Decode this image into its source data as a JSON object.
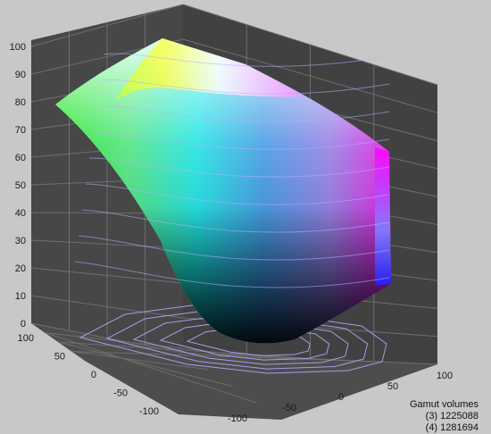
{
  "chart_data": {
    "type": "surface3d",
    "title": "",
    "z_axis": {
      "ticks": [
        "0",
        "10",
        "20",
        "30",
        "40",
        "50",
        "60",
        "70",
        "80",
        "90",
        "100"
      ],
      "range": [
        0,
        100
      ]
    },
    "left_axis": {
      "ticks": [
        "100",
        "50",
        "0",
        "-50",
        "-100"
      ],
      "range": [
        -100,
        100
      ]
    },
    "right_axis": {
      "ticks": [
        "-100",
        "-50",
        "0",
        "50",
        "100"
      ],
      "range": [
        -100,
        100
      ]
    },
    "grid": true,
    "legend": {
      "title": "Gamut volumes",
      "entries": [
        {
          "label": "(3)",
          "value": "1225088"
        },
        {
          "label": "(4)",
          "value": "1281694"
        }
      ],
      "placement": "bottom-right"
    }
  },
  "colors": {
    "background": "#c8c8c8",
    "pane": "#4a4a4a",
    "grid": "#6b6b6b",
    "contour": "#9c94e0"
  }
}
